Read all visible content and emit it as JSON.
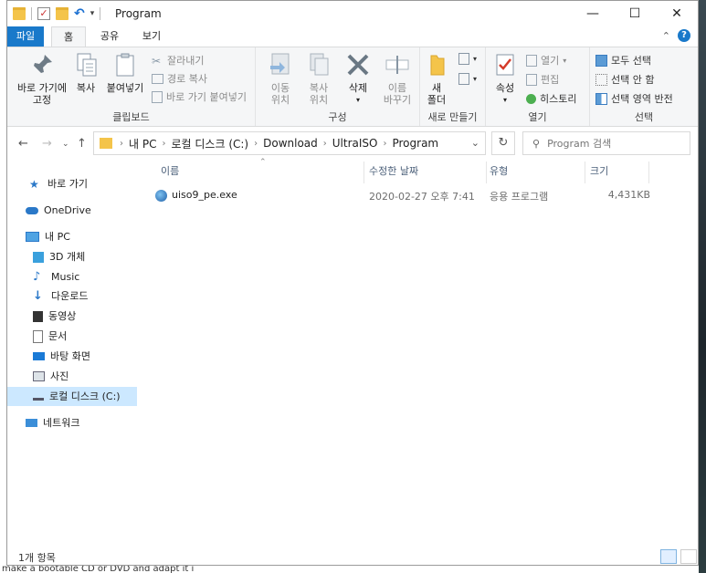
{
  "title": "Program",
  "window_controls": {
    "minimize": "—",
    "maximize": "☐",
    "close": "✕"
  },
  "tabs": {
    "file": "파일",
    "home": "홈",
    "share": "공유",
    "view": "보기"
  },
  "ribbon": {
    "clipboard": {
      "label": "클립보드",
      "pin": "바로 가기에\n고정",
      "pin_l1": "바로 가기에",
      "pin_l2": "고정",
      "copy": "복사",
      "paste": "붙여넣기",
      "cut": "잘라내기",
      "copy_path": "경로 복사",
      "paste_shortcut": "바로 가기 붙여넣기"
    },
    "organize": {
      "label": "구성",
      "move_l1": "이동",
      "move_l2": "위치",
      "copy_l1": "복사",
      "copy_l2": "위치",
      "delete": "삭제",
      "rename_l1": "이름",
      "rename_l2": "바꾸기"
    },
    "new": {
      "label": "새로 만들기",
      "new_folder_l1": "새",
      "new_folder_l2": "폴더"
    },
    "open": {
      "label": "열기",
      "properties": "속성",
      "open": "열기",
      "edit": "편집",
      "history": "히스토리"
    },
    "select": {
      "label": "선택",
      "select_all": "모두 선택",
      "select_none": "선택 안 함",
      "invert": "선택 영역 반전"
    }
  },
  "address": {
    "crumbs": [
      "내 PC",
      "로컬 디스크 (C:)",
      "Download",
      "UltraISO",
      "Program"
    ]
  },
  "search": {
    "placeholder": "Program 검색"
  },
  "nav": {
    "quick_access": "바로 가기",
    "onedrive": "OneDrive",
    "this_pc": "내 PC",
    "objects_3d": "3D 개체",
    "music": "Music",
    "downloads": "다운로드",
    "videos": "동영상",
    "documents": "문서",
    "desktop": "바탕 화면",
    "pictures": "사진",
    "local_disk": "로컬 디스크 (C:)",
    "network": "네트워크"
  },
  "columns": {
    "name": "이름",
    "date": "수정한 날짜",
    "type": "유형",
    "size": "크기"
  },
  "files": [
    {
      "name": "uiso9_pe.exe",
      "date": "2020-02-27 오후 7:41",
      "type": "응용 프로그램",
      "size": "4,431KB"
    }
  ],
  "status": {
    "count": "1개 항목"
  },
  "background_text": "make a bootable CD or DVD and adapt it i",
  "colors": {
    "accent": "#1979ca",
    "selected": "#cce8ff",
    "folder": "#f4c44a"
  }
}
